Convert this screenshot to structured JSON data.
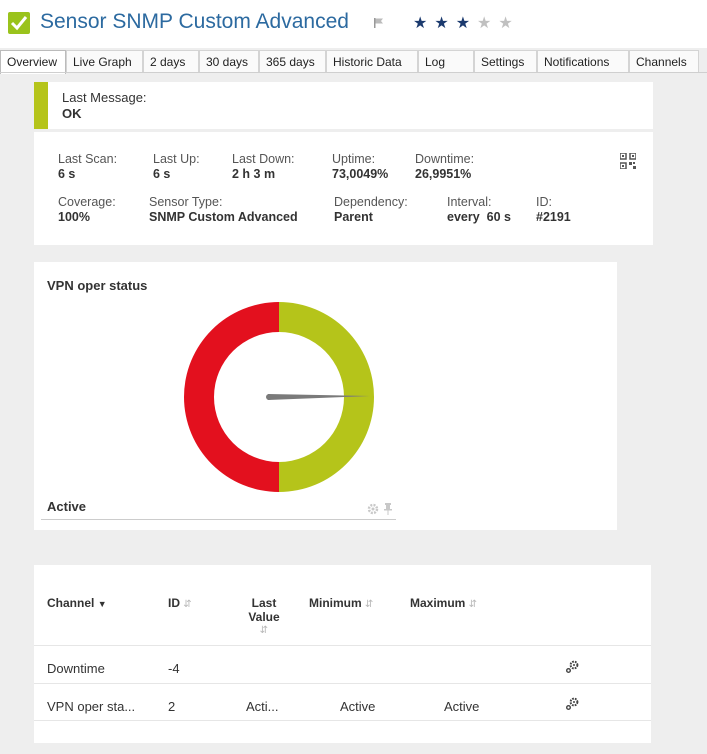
{
  "header": {
    "title": "Sensor SNMP Custom Advanced",
    "status_icon": "green-check-icon",
    "priority_stars": 3,
    "priority_max": 5
  },
  "tabs": [
    {
      "label": "Overview",
      "active": true
    },
    {
      "label": "Live Graph"
    },
    {
      "label": "2 days"
    },
    {
      "label": "30 days"
    },
    {
      "label": "365 days"
    },
    {
      "label": "Historic Data"
    },
    {
      "label": "Log"
    },
    {
      "label": "Settings"
    },
    {
      "label": "Notifications"
    },
    {
      "label": "Channels"
    }
  ],
  "message": {
    "label": "Last Message:",
    "value": "OK"
  },
  "stats": {
    "last_scan": {
      "label": "Last Scan:",
      "value": "6 s"
    },
    "last_up": {
      "label": "Last Up:",
      "value": "6 s"
    },
    "last_down": {
      "label": "Last Down:",
      "value": "2 h 3 m"
    },
    "uptime": {
      "label": "Uptime:",
      "value": "73,0049%"
    },
    "downtime": {
      "label": "Downtime:",
      "value": "26,9951%"
    },
    "coverage": {
      "label": "Coverage:",
      "value": "100%"
    },
    "sensor_type": {
      "label": "Sensor Type:",
      "value": "SNMP Custom Advanced"
    },
    "dependency": {
      "label": "Dependency:",
      "value": "Parent"
    },
    "interval": {
      "label": "Interval:",
      "value": "every  60 s"
    },
    "id": {
      "label": "ID:",
      "value": "#2191"
    }
  },
  "gauge": {
    "title": "VPN oper status",
    "state_label": "Active",
    "colors": {
      "down": "#e3101e",
      "up": "#b5c41a",
      "needle": "#7a7a7a"
    }
  },
  "channels_table": {
    "headers": {
      "channel": "Channel",
      "id": "ID",
      "last_value_1": "Last",
      "last_value_2": "Value",
      "minimum": "Minimum",
      "maximum": "Maximum"
    },
    "rows": [
      {
        "channel": "Downtime",
        "id": "-4",
        "last_value": "",
        "minimum": "",
        "maximum": ""
      },
      {
        "channel": "VPN oper sta...",
        "id": "2",
        "last_value": "Acti...",
        "minimum": "Active",
        "maximum": "Active"
      }
    ]
  }
}
